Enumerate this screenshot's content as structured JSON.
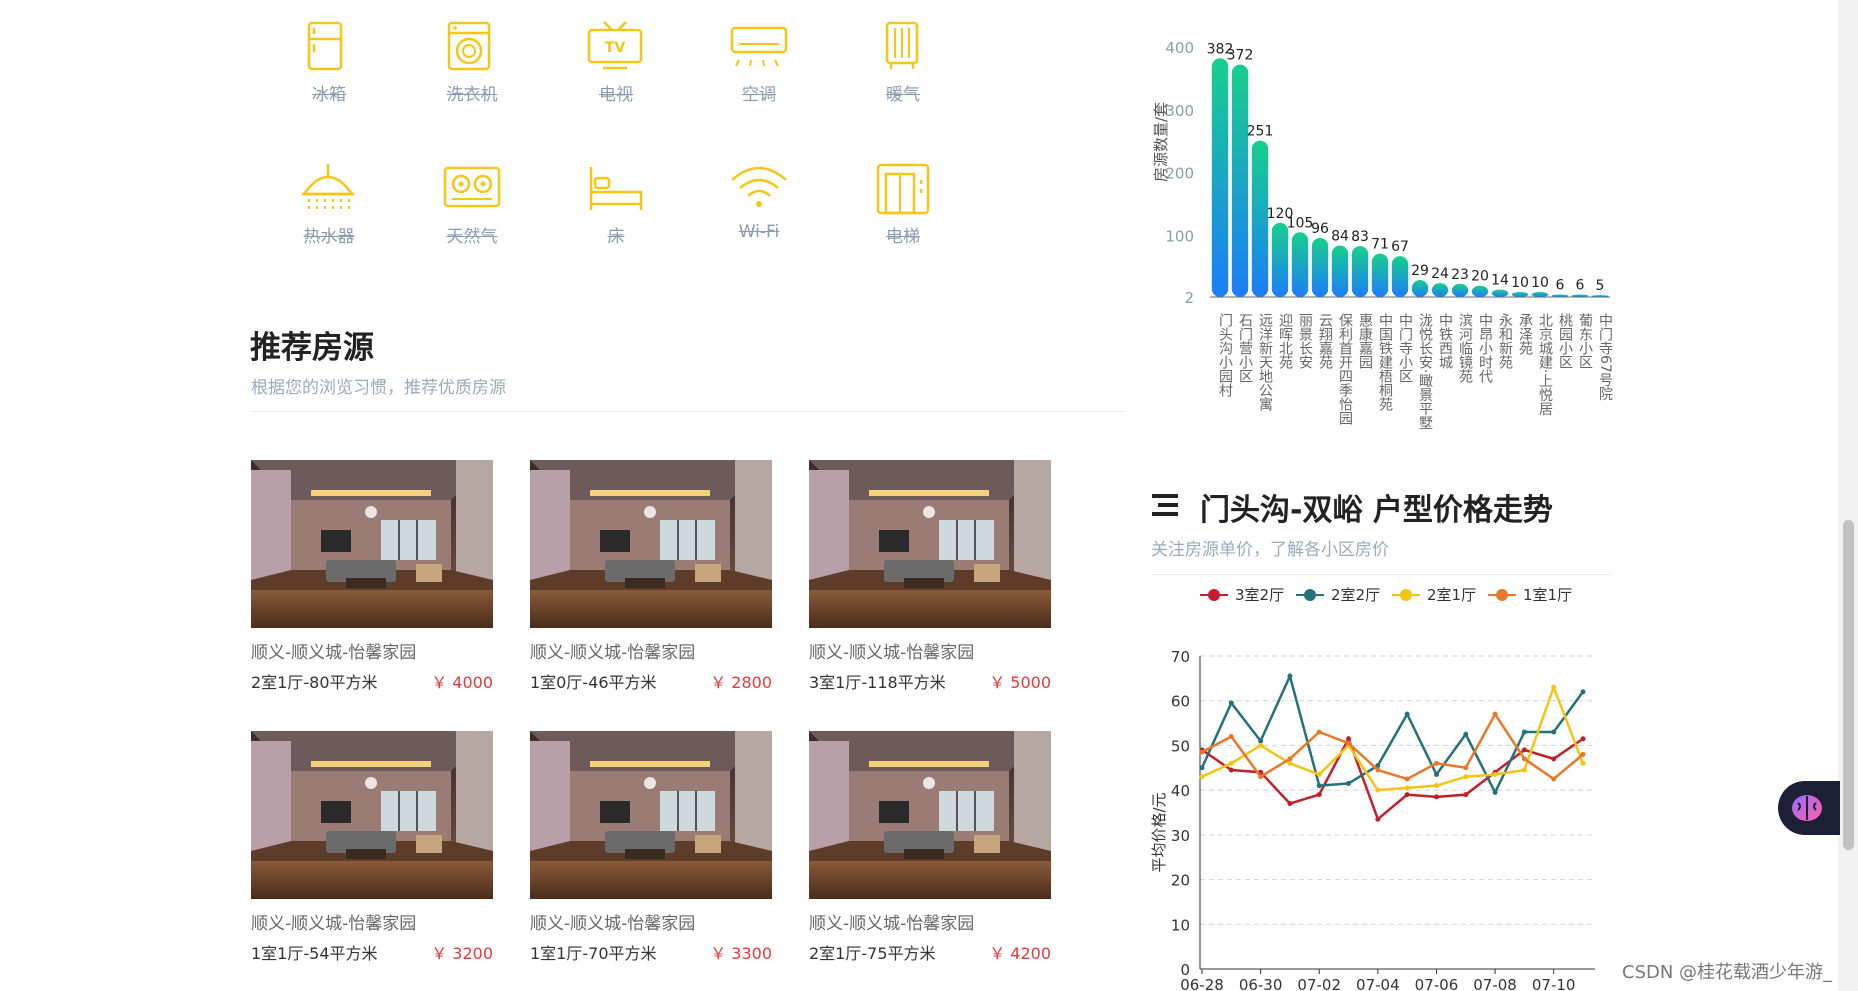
{
  "facilities": [
    {
      "label": "冰箱",
      "icon": "fridge-icon"
    },
    {
      "label": "洗衣机",
      "icon": "washer-icon"
    },
    {
      "label": "电视",
      "icon": "tv-icon",
      "icon_text": "TV"
    },
    {
      "label": "空调",
      "icon": "air-conditioner-icon"
    },
    {
      "label": "暖气",
      "icon": "heater-icon"
    },
    {
      "label": "热水器",
      "icon": "shower-icon"
    },
    {
      "label": "天然气",
      "icon": "gas-stove-icon"
    },
    {
      "label": "床",
      "icon": "bed-icon"
    },
    {
      "label": "Wi-Fi",
      "icon": "wifi-icon"
    },
    {
      "label": "电梯",
      "icon": "elevator-icon"
    }
  ],
  "icon_color": "#f5c518",
  "recommend": {
    "title": "推荐房源",
    "subtitle": "根据您的浏览习惯，推荐优质房源",
    "listings": [
      {
        "name": "顺义-顺义城-怡馨家园",
        "spec": "2室1厅-80平方米",
        "price": "￥ 4000"
      },
      {
        "name": "顺义-顺义城-怡馨家园",
        "spec": "1室0厅-46平方米",
        "price": "￥ 2800"
      },
      {
        "name": "顺义-顺义城-怡馨家园",
        "spec": "3室1厅-118平方米",
        "price": "￥ 5000"
      },
      {
        "name": "顺义-顺义城-怡馨家园",
        "spec": "1室1厅-54平方米",
        "price": "￥ 3200"
      },
      {
        "name": "顺义-顺义城-怡馨家园",
        "spec": "1室1厅-70平方米",
        "price": "￥ 3300"
      },
      {
        "name": "顺义-顺义城-怡馨家园",
        "spec": "2室1厅-75平方米",
        "price": "￥ 4200"
      }
    ]
  },
  "trend": {
    "title": "门头沟-双峪 户型价格走势",
    "subtitle": "关注房源单价，了解各小区房价"
  },
  "watermark": "CSDN @桂花载酒少年游_",
  "chart_data": [
    {
      "type": "bar",
      "ylabel": "房源数量/套",
      "yticks": [
        "2",
        "100",
        "200",
        "300",
        "400"
      ],
      "ylim": [
        2,
        400
      ],
      "categories": [
        "门头沟小园村",
        "石门营小区",
        "远洋新天地公寓",
        "迎晖北苑",
        "丽景长安",
        "云翔嘉苑",
        "保利首开四季怡园",
        "惠康嘉园",
        "中国铁建梧桐苑",
        "中门寺小区",
        "泷悦长安·瞰景平墅",
        "中铁西城",
        "滨河临镜苑",
        "中昂小时代",
        "永和新苑",
        "承泽苑",
        "北京城建·上悦居",
        "桃园小区",
        "葡东小区",
        "中门寺67号院"
      ],
      "values": [
        382,
        372,
        251,
        120,
        105,
        96,
        84,
        83,
        71,
        67,
        29,
        24,
        23,
        20,
        14,
        10,
        10,
        6,
        6,
        5
      ],
      "colors": {
        "top": "#17cf8c",
        "bottom": "#1c7dfa"
      },
      "grid": false
    },
    {
      "type": "line",
      "ylabel": "平均价格/元",
      "ylim": [
        0,
        70
      ],
      "yticks": [
        0,
        10,
        20,
        30,
        40,
        50,
        60,
        70
      ],
      "xtick_labels": [
        "06-28",
        "06-30",
        "07-02",
        "07-04",
        "07-06",
        "07-08",
        "07-10"
      ],
      "grid": true,
      "legend_position": "top-center",
      "series": [
        {
          "name": "3室2厅",
          "color": "#c0202a",
          "values": [
            49,
            44.5,
            44,
            37,
            39,
            51.5,
            33.5,
            39,
            38.5,
            39,
            44,
            49,
            47,
            51.5
          ]
        },
        {
          "name": "2室2厅",
          "color": "#25717a",
          "values": [
            45,
            59.5,
            51,
            65.5,
            41,
            41.5,
            45.5,
            57,
            43.5,
            52.5,
            39.5,
            53,
            53,
            62
          ]
        },
        {
          "name": "2室1厅",
          "color": "#f4c414",
          "values": [
            43,
            46,
            50,
            46,
            43.5,
            50,
            40,
            40.5,
            41,
            43,
            43.5,
            44.5,
            63,
            46
          ]
        },
        {
          "name": "1室1厅",
          "color": "#e8782a",
          "values": [
            48.5,
            52,
            43,
            47,
            53,
            50.5,
            44.5,
            42.5,
            46,
            45,
            57,
            47,
            42.5,
            48
          ]
        }
      ]
    }
  ]
}
